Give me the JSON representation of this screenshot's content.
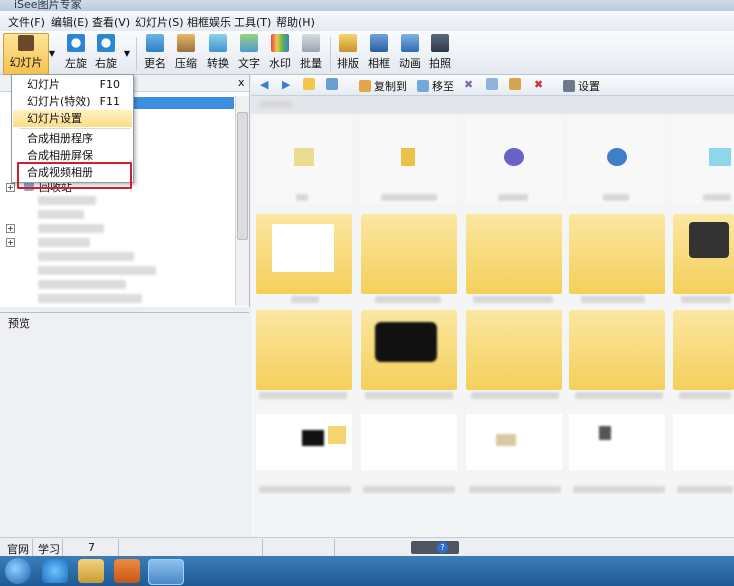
{
  "window": {
    "title": "iSee图片专家"
  },
  "menubar": [
    "文件(F)",
    "编辑(E)",
    "查看(V)",
    "幻灯片(S)",
    "相框娱乐",
    "工具(T)",
    "帮助(H)"
  ],
  "toolbar": {
    "slideshow": "幻灯片",
    "rotate_left": "左旋",
    "rotate_right": "右旋",
    "rename": "更名",
    "compress": "压缩",
    "convert": "转换",
    "text": "文字",
    "watermark": "水印",
    "batch": "批量",
    "layout": "排版",
    "frame": "相框",
    "animation": "动画",
    "photo": "拍照"
  },
  "dropdown": {
    "items": [
      {
        "label": "幻灯片",
        "shortcut": "F10"
      },
      {
        "label": "幻灯片(特效)",
        "shortcut": "F11"
      },
      {
        "label": "幻灯片设置",
        "shortcut": ""
      },
      {
        "label": "合成相册程序",
        "shortcut": ""
      },
      {
        "label": "合成相册屏保",
        "shortcut": ""
      },
      {
        "label": "合成视频相册",
        "shortcut": ""
      }
    ]
  },
  "tree": {
    "close": "x",
    "recycle_bin": "回收站"
  },
  "preview": {
    "label": "预览"
  },
  "right_toolbar": {
    "copy_to": "复制到",
    "move_to": "移至",
    "settings": "设置"
  },
  "statusbar": {
    "official_site": "官网",
    "learn": "学习",
    "count": "7"
  },
  "colors": {
    "accent_yellow": "#f5c24d",
    "highlight_border": "#d21f2f",
    "taskbar": "#1f5a93"
  }
}
